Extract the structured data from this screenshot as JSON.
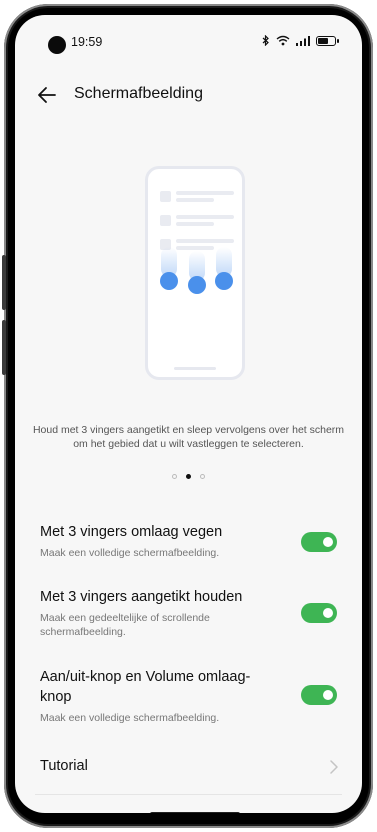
{
  "status_bar": {
    "time": "19:59",
    "icons": [
      "bluetooth-icon",
      "wifi-icon",
      "signal-icon",
      "battery-icon"
    ],
    "battery_level": 0.55
  },
  "header": {
    "title": "Schermafbeelding",
    "back_icon": "arrow-left-icon"
  },
  "illustration": {
    "description_text": "Houd met 3 vingers aangetikt en sleep vervolgens over het scherm om het gebied dat u wilt vastleggen te selecteren."
  },
  "pager": {
    "count": 3,
    "active_index": 1
  },
  "settings": [
    {
      "title": "Met 3 vingers omlaag vegen",
      "subtitle": "Maak een volledige schermafbeelding.",
      "enabled": true
    },
    {
      "title": "Met 3 vingers aangetikt houden",
      "subtitle": "Maak een gedeeltelijke of scrollende schermafbeelding.",
      "enabled": true
    },
    {
      "title": "Aan/uit-knop en Volume omlaag-knop",
      "subtitle": "Maak een volledige schermafbeelding.",
      "enabled": true
    }
  ],
  "tutorial": {
    "label": "Tutorial",
    "icon": "chevron-right-icon"
  },
  "colors": {
    "accent": "#3eb554",
    "illustration_blue": "#4a90eb"
  }
}
